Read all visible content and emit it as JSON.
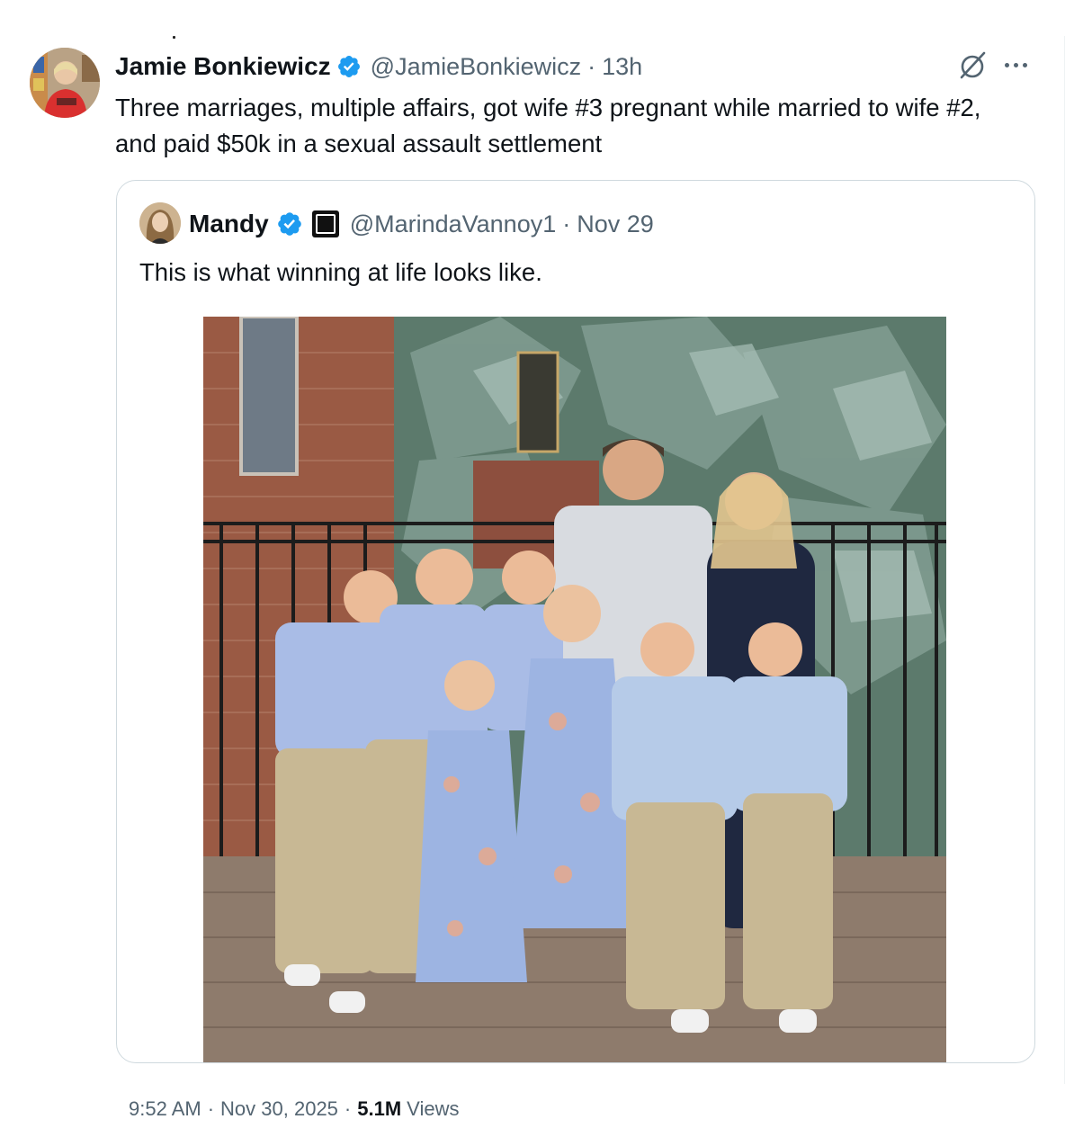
{
  "tweet": {
    "author": {
      "display_name": "Jamie Bonkiewicz",
      "handle": "@JamieBonkiewicz",
      "verified": true,
      "avatar": "avatar-photo"
    },
    "separator": "·",
    "time_ago": "13h",
    "text": "Three marriages, multiple affairs, got wife #3 pregnant while married to wife #2, and paid $50k in a sexual assault settlement",
    "icons": {
      "grok": "grok-icon",
      "more": "more-icon",
      "verified": "verified-badge-icon"
    }
  },
  "quote": {
    "author": {
      "display_name": "Mandy",
      "handle": "@MarindaVannoy1",
      "verified": true,
      "affiliate_badge": "affiliate-badge-icon"
    },
    "separator": "·",
    "date": "Nov 29",
    "text": "This is what winning at life looks like.",
    "photo": "family-photo"
  },
  "footer": {
    "time": "9:52 AM",
    "separator": "·",
    "date": "Nov 30, 2025",
    "views_count": "5.1M",
    "views_label": "Views"
  },
  "colors": {
    "primary_text": "#0f1419",
    "secondary_text": "#536471",
    "verified_blue": "#1d9bf0",
    "border": "#cfd9de"
  }
}
